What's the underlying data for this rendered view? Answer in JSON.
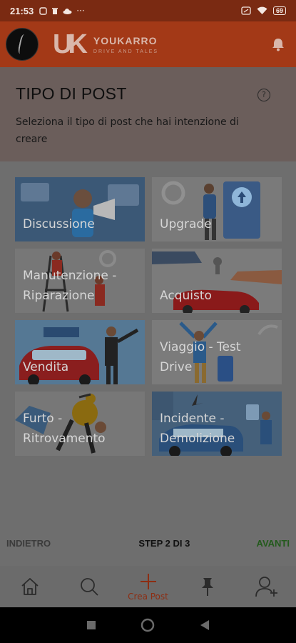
{
  "statusbar": {
    "time": "21:53",
    "battery": "69"
  },
  "header": {
    "brand": "YOUKARRO",
    "tagline": "DRIVE AND TALES",
    "logo_mark": "UK"
  },
  "intro": {
    "title": "TIPO DI POST",
    "subtitle": "Seleziona il tipo di post che hai intenzione di creare",
    "help": "?"
  },
  "post_types": [
    {
      "label": "Discussione"
    },
    {
      "label": "Upgrade"
    },
    {
      "label": "Manutenzione - Riparazione"
    },
    {
      "label": "Acquisto"
    },
    {
      "label": "Vendita"
    },
    {
      "label": "Viaggio - Test Drive"
    },
    {
      "label": "Furto - Ritrovamento"
    },
    {
      "label": "Incidente - Demolizione"
    }
  ],
  "stepnav": {
    "back": "INDIETRO",
    "step": "STEP 2 DI 3",
    "next": "AVANTI"
  },
  "tabbar": {
    "create_label": "Crea Post"
  },
  "colors": {
    "accent": "#a33917",
    "next": "#235a1c"
  }
}
